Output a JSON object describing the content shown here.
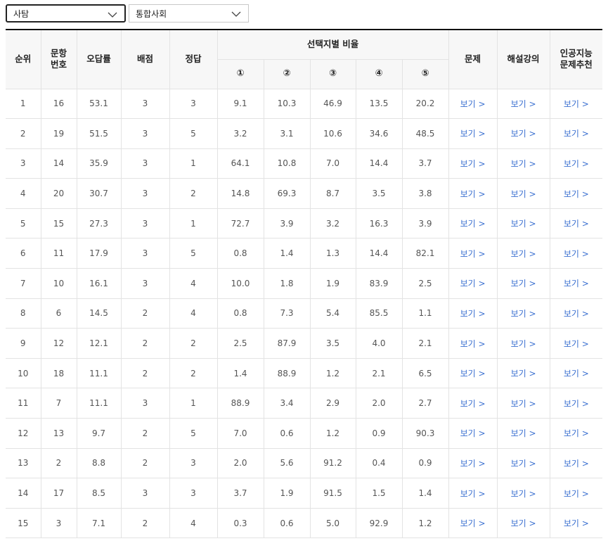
{
  "filters": {
    "subject_area": "사탐",
    "subject": "통합사회"
  },
  "table": {
    "headers": {
      "rank": "순위",
      "question_no": "문항\n번호",
      "wrong_rate": "오답률",
      "points": "배점",
      "answer": "정답",
      "choice_ratio": "선택지별 비율",
      "choices": [
        "①",
        "②",
        "③",
        "④",
        "⑤"
      ],
      "problem": "문제",
      "lecture": "해설강의",
      "ai": "인공지능\n문제추천"
    },
    "link_label": "보기 >",
    "rows": [
      {
        "rank": "1",
        "no": "16",
        "wrong": "53.1",
        "points": "3",
        "answer": "3",
        "c": [
          "9.1",
          "10.3",
          "46.9",
          "13.5",
          "20.2"
        ]
      },
      {
        "rank": "2",
        "no": "19",
        "wrong": "51.5",
        "points": "3",
        "answer": "5",
        "c": [
          "3.2",
          "3.1",
          "10.6",
          "34.6",
          "48.5"
        ]
      },
      {
        "rank": "3",
        "no": "14",
        "wrong": "35.9",
        "points": "3",
        "answer": "1",
        "c": [
          "64.1",
          "10.8",
          "7.0",
          "14.4",
          "3.7"
        ]
      },
      {
        "rank": "4",
        "no": "20",
        "wrong": "30.7",
        "points": "3",
        "answer": "2",
        "c": [
          "14.8",
          "69.3",
          "8.7",
          "3.5",
          "3.8"
        ]
      },
      {
        "rank": "5",
        "no": "15",
        "wrong": "27.3",
        "points": "3",
        "answer": "1",
        "c": [
          "72.7",
          "3.9",
          "3.2",
          "16.3",
          "3.9"
        ]
      },
      {
        "rank": "6",
        "no": "11",
        "wrong": "17.9",
        "points": "3",
        "answer": "5",
        "c": [
          "0.8",
          "1.4",
          "1.3",
          "14.4",
          "82.1"
        ]
      },
      {
        "rank": "7",
        "no": "10",
        "wrong": "16.1",
        "points": "3",
        "answer": "4",
        "c": [
          "10.0",
          "1.8",
          "1.9",
          "83.9",
          "2.5"
        ]
      },
      {
        "rank": "8",
        "no": "6",
        "wrong": "14.5",
        "points": "2",
        "answer": "4",
        "c": [
          "0.8",
          "7.3",
          "5.4",
          "85.5",
          "1.1"
        ]
      },
      {
        "rank": "9",
        "no": "12",
        "wrong": "12.1",
        "points": "2",
        "answer": "2",
        "c": [
          "2.5",
          "87.9",
          "3.5",
          "4.0",
          "2.1"
        ]
      },
      {
        "rank": "10",
        "no": "18",
        "wrong": "11.1",
        "points": "2",
        "answer": "2",
        "c": [
          "1.4",
          "88.9",
          "1.2",
          "2.1",
          "6.5"
        ]
      },
      {
        "rank": "11",
        "no": "7",
        "wrong": "11.1",
        "points": "3",
        "answer": "1",
        "c": [
          "88.9",
          "3.4",
          "2.9",
          "2.0",
          "2.7"
        ]
      },
      {
        "rank": "12",
        "no": "13",
        "wrong": "9.7",
        "points": "2",
        "answer": "5",
        "c": [
          "7.0",
          "0.6",
          "1.2",
          "0.9",
          "90.3"
        ]
      },
      {
        "rank": "13",
        "no": "2",
        "wrong": "8.8",
        "points": "2",
        "answer": "3",
        "c": [
          "2.0",
          "5.6",
          "91.2",
          "0.4",
          "0.9"
        ]
      },
      {
        "rank": "14",
        "no": "17",
        "wrong": "8.5",
        "points": "3",
        "answer": "3",
        "c": [
          "3.7",
          "1.9",
          "91.5",
          "1.5",
          "1.4"
        ]
      },
      {
        "rank": "15",
        "no": "3",
        "wrong": "7.1",
        "points": "2",
        "answer": "4",
        "c": [
          "0.3",
          "0.6",
          "5.0",
          "92.9",
          "1.2"
        ]
      }
    ]
  },
  "colors": {
    "link": "#3a6fd0",
    "header_bg": "#f7f7f7",
    "top_rule": "#111111"
  },
  "icons": {
    "dropdown": "chevron-down-icon"
  }
}
